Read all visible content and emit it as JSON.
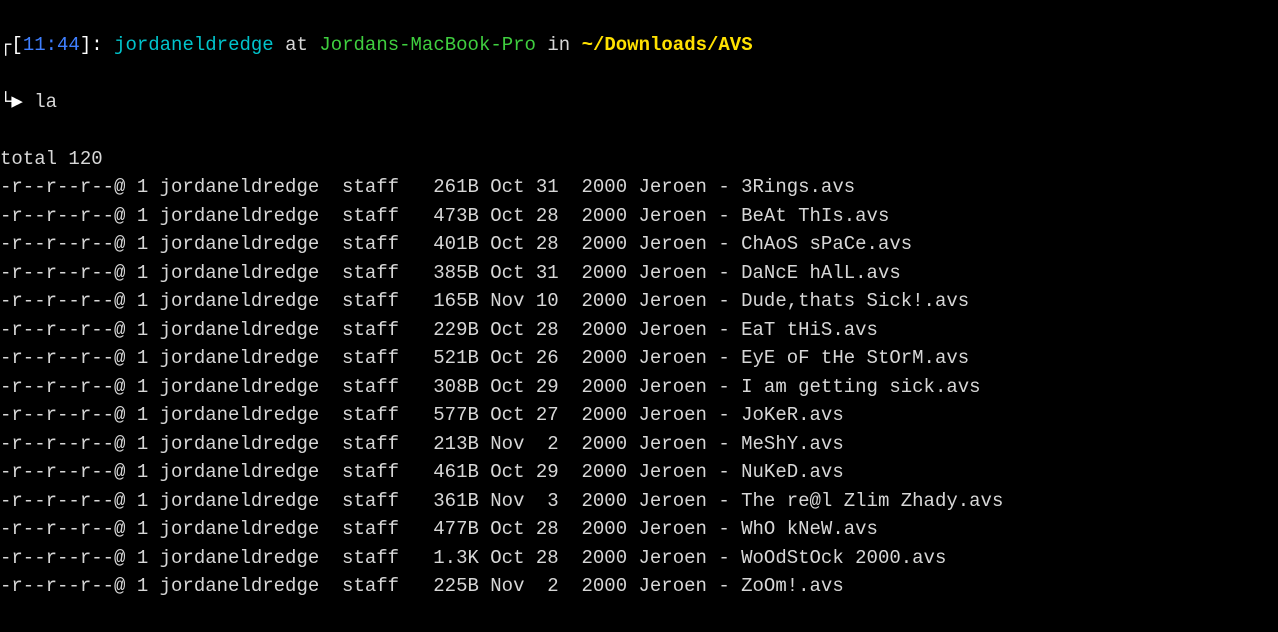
{
  "prompt": {
    "open_bracket": "┌[",
    "time": "11:44",
    "close_bracket": "]:",
    "user": "jordaneldredge",
    "at": "at",
    "host": "Jordans-MacBook-Pro",
    "in": "in",
    "path": "~/Downloads/AVS",
    "arrow": "└▶ ",
    "command": "la"
  },
  "total_line": "total 120",
  "rows": [
    {
      "perm": "-r--r--r--@",
      "links": "1",
      "owner": "jordaneldredge",
      "group": "staff",
      "size": "261B",
      "month": "Oct",
      "day": "31",
      "year": "2000",
      "name": "Jeroen - 3Rings.avs"
    },
    {
      "perm": "-r--r--r--@",
      "links": "1",
      "owner": "jordaneldredge",
      "group": "staff",
      "size": "473B",
      "month": "Oct",
      "day": "28",
      "year": "2000",
      "name": "Jeroen - BeAt ThIs.avs"
    },
    {
      "perm": "-r--r--r--@",
      "links": "1",
      "owner": "jordaneldredge",
      "group": "staff",
      "size": "401B",
      "month": "Oct",
      "day": "28",
      "year": "2000",
      "name": "Jeroen - ChAoS sPaCe.avs"
    },
    {
      "perm": "-r--r--r--@",
      "links": "1",
      "owner": "jordaneldredge",
      "group": "staff",
      "size": "385B",
      "month": "Oct",
      "day": "31",
      "year": "2000",
      "name": "Jeroen - DaNcE hAlL.avs"
    },
    {
      "perm": "-r--r--r--@",
      "links": "1",
      "owner": "jordaneldredge",
      "group": "staff",
      "size": "165B",
      "month": "Nov",
      "day": "10",
      "year": "2000",
      "name": "Jeroen - Dude,thats Sick!.avs"
    },
    {
      "perm": "-r--r--r--@",
      "links": "1",
      "owner": "jordaneldredge",
      "group": "staff",
      "size": "229B",
      "month": "Oct",
      "day": "28",
      "year": "2000",
      "name": "Jeroen - EaT tHiS.avs"
    },
    {
      "perm": "-r--r--r--@",
      "links": "1",
      "owner": "jordaneldredge",
      "group": "staff",
      "size": "521B",
      "month": "Oct",
      "day": "26",
      "year": "2000",
      "name": "Jeroen - EyE oF tHe StOrM.avs"
    },
    {
      "perm": "-r--r--r--@",
      "links": "1",
      "owner": "jordaneldredge",
      "group": "staff",
      "size": "308B",
      "month": "Oct",
      "day": "29",
      "year": "2000",
      "name": "Jeroen - I am getting sick.avs"
    },
    {
      "perm": "-r--r--r--@",
      "links": "1",
      "owner": "jordaneldredge",
      "group": "staff",
      "size": "577B",
      "month": "Oct",
      "day": "27",
      "year": "2000",
      "name": "Jeroen - JoKeR.avs"
    },
    {
      "perm": "-r--r--r--@",
      "links": "1",
      "owner": "jordaneldredge",
      "group": "staff",
      "size": "213B",
      "month": "Nov",
      "day": " 2",
      "year": "2000",
      "name": "Jeroen - MeShY.avs"
    },
    {
      "perm": "-r--r--r--@",
      "links": "1",
      "owner": "jordaneldredge",
      "group": "staff",
      "size": "461B",
      "month": "Oct",
      "day": "29",
      "year": "2000",
      "name": "Jeroen - NuKeD.avs"
    },
    {
      "perm": "-r--r--r--@",
      "links": "1",
      "owner": "jordaneldredge",
      "group": "staff",
      "size": "361B",
      "month": "Nov",
      "day": " 3",
      "year": "2000",
      "name": "Jeroen - The re@l Zlim Zhady.avs"
    },
    {
      "perm": "-r--r--r--@",
      "links": "1",
      "owner": "jordaneldredge",
      "group": "staff",
      "size": "477B",
      "month": "Oct",
      "day": "28",
      "year": "2000",
      "name": "Jeroen - WhO kNeW.avs"
    },
    {
      "perm": "-r--r--r--@",
      "links": "1",
      "owner": "jordaneldredge",
      "group": "staff",
      "size": "1.3K",
      "month": "Oct",
      "day": "28",
      "year": "2000",
      "name": "Jeroen - WoOdStOck 2000.avs"
    },
    {
      "perm": "-r--r--r--@",
      "links": "1",
      "owner": "jordaneldredge",
      "group": "staff",
      "size": "225B",
      "month": "Nov",
      "day": " 2",
      "year": "2000",
      "name": "Jeroen - ZoOm!.avs"
    }
  ]
}
